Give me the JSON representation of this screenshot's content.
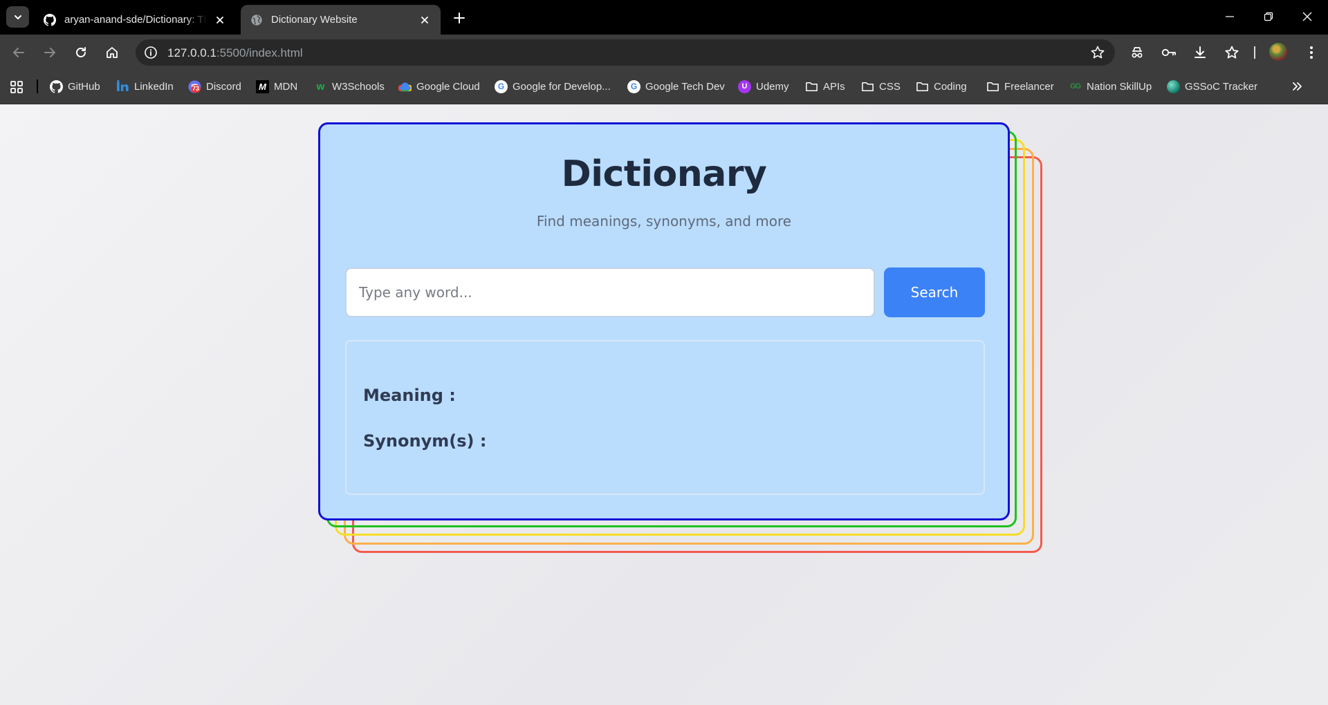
{
  "browser": {
    "tabs": [
      {
        "title": "aryan-anand-sde/Dictionary: This",
        "active": false,
        "icon": "github-icon"
      },
      {
        "title": "Dictionary Website",
        "active": true,
        "icon": "globe-icon"
      }
    ],
    "url": {
      "host": "127.0.0.1",
      "path": ":5500/index.html"
    },
    "bookmarks": [
      {
        "label": "GitHub",
        "icon": "github-icon"
      },
      {
        "label": "LinkedIn",
        "icon": "linkedin-icon"
      },
      {
        "label": "Discord",
        "icon": "discord-icon",
        "badge": "73"
      },
      {
        "label": "MDN",
        "icon": "mdn-icon"
      },
      {
        "label": "W3Schools",
        "icon": "w3schools-icon"
      },
      {
        "label": "Google Cloud",
        "icon": "google-cloud-icon"
      },
      {
        "label": "Google for Develop...",
        "icon": "google-icon"
      },
      {
        "label": "Google Tech Dev",
        "icon": "google-icon"
      },
      {
        "label": "Udemy",
        "icon": "udemy-icon"
      },
      {
        "label": "APIs",
        "icon": "folder-icon"
      },
      {
        "label": "CSS",
        "icon": "folder-icon"
      },
      {
        "label": "Coding",
        "icon": "folder-icon"
      },
      {
        "label": "Freelancer",
        "icon": "folder-icon"
      },
      {
        "label": "Nation SkillUp",
        "icon": "geeksforgeeks-icon"
      },
      {
        "label": "GSSoC Tracker",
        "icon": "globe-icon"
      }
    ]
  },
  "app": {
    "title": "Dictionary",
    "subtitle": "Find meanings, synonyms, and more",
    "search": {
      "placeholder": "Type any word...",
      "button_label": "Search"
    },
    "results": {
      "meaning_label": "Meaning :",
      "synonyms_label": "Synonym(s) :"
    }
  },
  "colors": {
    "card_bg": "#badcfd",
    "card_border": "#1011d6",
    "layer_green": "#1fc11f",
    "layer_yellow": "#f7dd27",
    "layer_orange": "#fbb04a",
    "layer_red": "#f45a4e",
    "button": "#3b82f6"
  }
}
